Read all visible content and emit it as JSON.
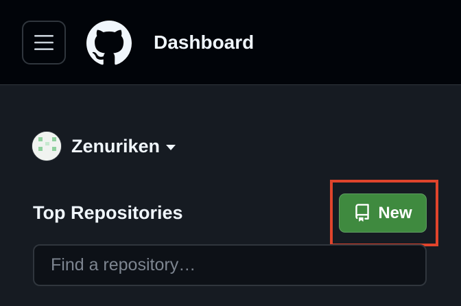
{
  "header": {
    "menu_icon": "hamburger-icon",
    "logo_icon": "github-octocat-icon",
    "title": "Dashboard"
  },
  "account": {
    "avatar_icon": "identicon-avatar",
    "name": "Zenuriken",
    "dropdown_icon": "caret-down-icon"
  },
  "repositories": {
    "title": "Top Repositories",
    "new_button": {
      "icon": "repo-icon",
      "label": "New"
    },
    "search": {
      "placeholder": "Find a repository…",
      "value": ""
    }
  },
  "highlight": {
    "target": "new-button",
    "color": "#e0442c"
  },
  "colors": {
    "header_bg": "#010409",
    "page_bg": "#161b22",
    "border": "#30363d",
    "button_green": "#3f8a3f",
    "text": "#f0f6fc",
    "placeholder": "#7d8590"
  }
}
